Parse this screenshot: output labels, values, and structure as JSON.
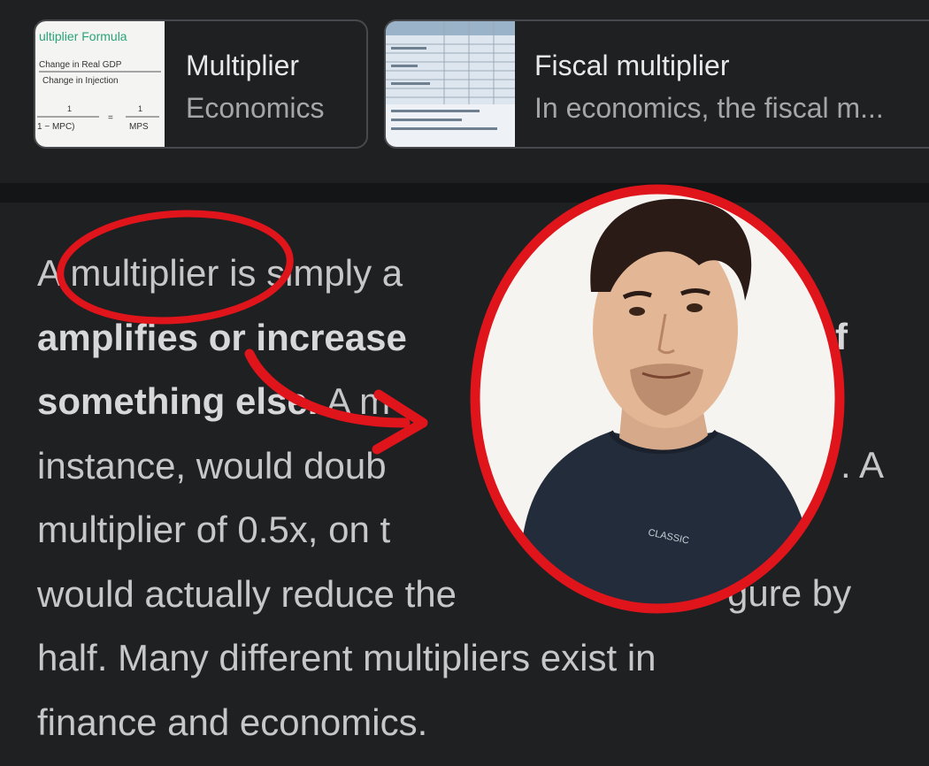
{
  "cards": [
    {
      "title": "Multiplier",
      "subtitle": "Economics",
      "thumbnail": {
        "heading": "ultiplier Formula",
        "line1": "Change in Real GDP",
        "line2": "Change in Injection",
        "formula_left": "1 − MPC)",
        "formula_right": "MPS",
        "numerator": "1"
      }
    },
    {
      "title": "Fiscal multiplier",
      "subtitle": "In economics, the fiscal m..."
    }
  ],
  "article": {
    "lines": [
      {
        "text": "A multiplier is simply a",
        "bold": false
      },
      {
        "text": "amplifies or increase",
        "bold": true
      },
      {
        "text": "something else.",
        "bold": true,
        "rest": " A m"
      },
      {
        "text": "instance, would doub",
        "bold": false
      },
      {
        "text": "multiplier of 0.5x, on t",
        "bold": false
      },
      {
        "text": "would actually reduce the",
        "bold": false,
        "rest_right": "gure by"
      },
      {
        "text": "half. Many different multipliers exist in",
        "bold": false
      },
      {
        "text": "finance and economics.",
        "bold": false
      }
    ],
    "right_fragments": {
      "line2": "f",
      "line4": ". A"
    },
    "shirt_text": "CLASSIC"
  },
  "colors": {
    "annotation_red": "#e0141b",
    "background": "#1f2022",
    "text": "#c7c7c9"
  }
}
